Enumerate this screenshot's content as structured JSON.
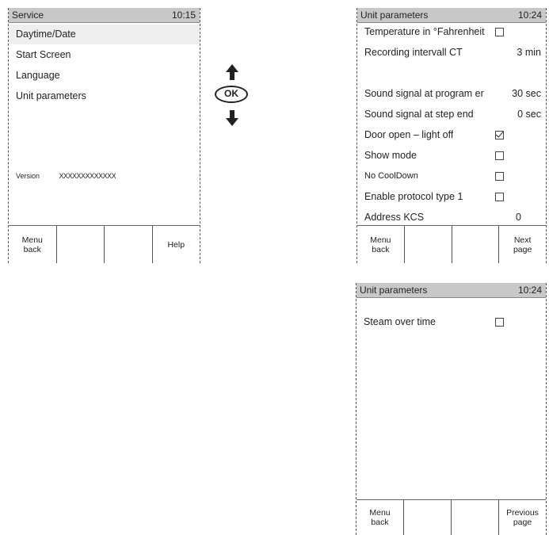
{
  "service_screen": {
    "title": "Service",
    "time": "10:15",
    "items": [
      {
        "label": "Daytime/Date"
      },
      {
        "label": "Start  Screen"
      },
      {
        "label": "Language"
      },
      {
        "label": "Unit  parameters"
      }
    ],
    "version_label": "Version",
    "version_value": "XXXXXXXXXXXXX",
    "softkeys": [
      "Menu\nback",
      "",
      "",
      "Help"
    ]
  },
  "nav_keys": {
    "ok_label": "OK",
    "up_icon": "arrow-up-icon",
    "down_icon": "arrow-down-icon"
  },
  "unit_params_page1": {
    "title": "Unit  parameters",
    "time": "10:24",
    "rows": [
      {
        "label": "Temperature  in  °Fahrenheit",
        "value": "",
        "checkbox": "unchecked"
      },
      {
        "label": "Recording  intervall  CT",
        "value": "3  min"
      },
      {
        "label": "",
        "value": ""
      },
      {
        "label": "Sound  signal  at  program  er",
        "value": "30  sec"
      },
      {
        "label": "Sound  signal  at  step  end",
        "value": "0  sec"
      },
      {
        "label": "Door  open  –  light  off",
        "checkbox": "checked"
      },
      {
        "label": "Show  mode",
        "checkbox": "unchecked"
      },
      {
        "label": "No CoolDown",
        "checkbox": "unchecked"
      },
      {
        "label": "Enable  protocol  type  1",
        "checkbox": "unchecked"
      },
      {
        "label": "Address  KCS",
        "value": "0"
      }
    ],
    "softkeys": [
      "Menu\nback",
      "",
      "",
      "Next\npage"
    ]
  },
  "unit_params_page2": {
    "title": "Unit  parameters",
    "time": "10:24",
    "rows": [
      {
        "label": "Steam over time",
        "checkbox": "unchecked"
      }
    ],
    "softkeys": [
      "Menu\nback",
      "",
      "",
      "Previous\npage"
    ]
  }
}
